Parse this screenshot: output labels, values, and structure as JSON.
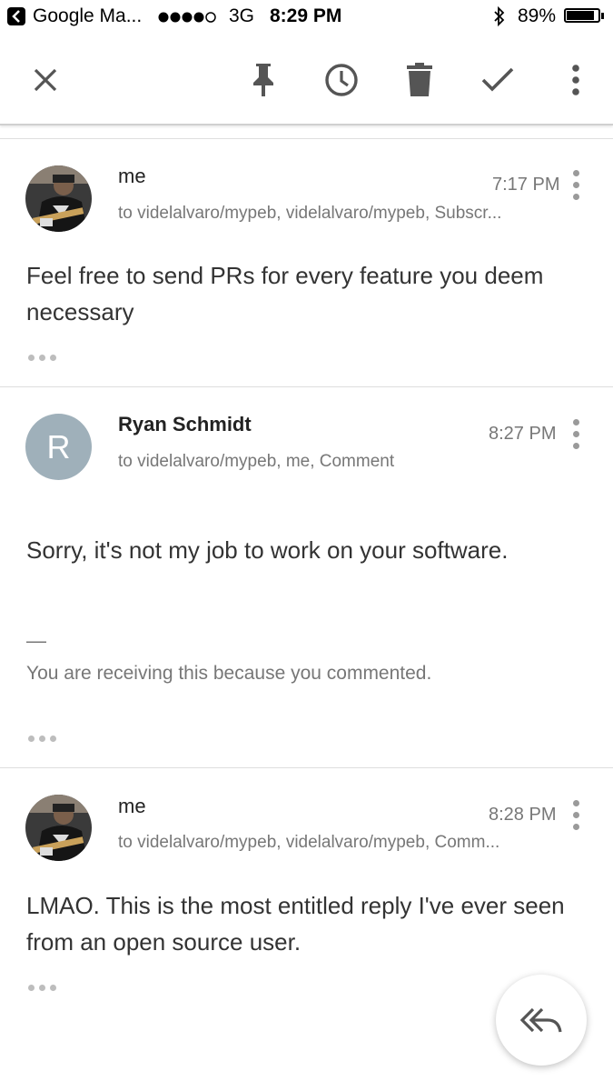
{
  "status_bar": {
    "app_name": "Google Ma...",
    "network": "3G",
    "time": "8:29 PM",
    "battery": "89%",
    "battery_level": 0.89
  },
  "toolbar": {
    "icons": [
      "close-icon",
      "pin-icon",
      "snooze-icon",
      "delete-icon",
      "done-icon",
      "more-icon"
    ]
  },
  "messages": [
    {
      "sender": "me",
      "time": "7:17 PM",
      "recipients": "to videlalvaro/mypeb, videlalvaro/mypeb, Subscr...",
      "body": "Feel free to send PRs for every feature you deem necessary"
    },
    {
      "sender": "Ryan Schmidt",
      "avatar_letter": "R",
      "avatar_color": "#9fb0ba",
      "time": "8:27 PM",
      "recipients": "to videlalvaro/mypeb, me, Comment",
      "body": "Sorry, it's not my job to work on your software.",
      "signature_dash": "—",
      "footer": "You are receiving this because you commented."
    },
    {
      "sender": "me",
      "time": "8:28 PM",
      "recipients": "to videlalvaro/mypeb, videlalvaro/mypeb, Comm...",
      "body": "LMAO. This is the most entitled reply I've ever seen from an open source user."
    }
  ],
  "fab": {
    "icon": "reply-all-icon"
  }
}
